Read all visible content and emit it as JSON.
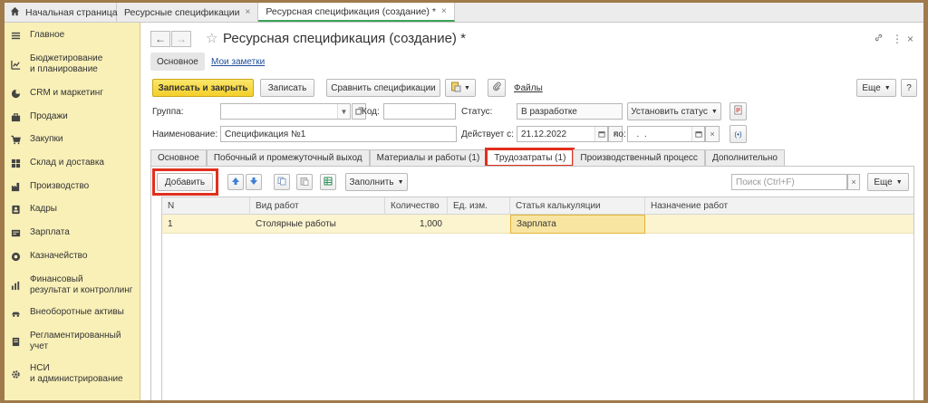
{
  "top_tabs": {
    "home_label": "Начальная страница",
    "tabs": [
      {
        "label": "Ресурсные спецификации",
        "close": "×"
      },
      {
        "label": "Ресурсная спецификация (создание) *",
        "close": "×"
      }
    ]
  },
  "sidebar": {
    "items": [
      {
        "label": "Главное",
        "icon": "menu-icon"
      },
      {
        "label": "Бюджетирование\nи планирование",
        "icon": "budget-icon"
      },
      {
        "label": "CRM и маркетинг",
        "icon": "crm-icon"
      },
      {
        "label": "Продажи",
        "icon": "sales-icon"
      },
      {
        "label": "Закупки",
        "icon": "cart-icon"
      },
      {
        "label": "Склад и доставка",
        "icon": "warehouse-icon"
      },
      {
        "label": "Производство",
        "icon": "factory-icon"
      },
      {
        "label": "Кадры",
        "icon": "staff-icon"
      },
      {
        "label": "Зарплата",
        "icon": "salary-icon"
      },
      {
        "label": "Казначейство",
        "icon": "treasury-icon"
      },
      {
        "label": "Финансовый\nрезультат и контроллинг",
        "icon": "finance-icon"
      },
      {
        "label": "Внеоборотные активы",
        "icon": "assets-icon"
      },
      {
        "label": "Регламентированный\nучет",
        "icon": "accounting-icon"
      },
      {
        "label": "НСИ\nи администрирование",
        "icon": "gear-icon"
      }
    ]
  },
  "header": {
    "back": "←",
    "forward": "→",
    "star": "☆",
    "title": "Ресурсная спецификация (создание) *",
    "link_icon": "🔗",
    "more_icon": "⋮",
    "close_icon": "×"
  },
  "form_tabs_top": {
    "main": "Основное",
    "notes": "Мои заметки"
  },
  "toolbar": {
    "save_close": "Записать и закрыть",
    "save": "Записать",
    "compare": "Сравнить спецификации",
    "files": "Файлы",
    "more": "Еще",
    "help": "?"
  },
  "fields": {
    "group_label": "Группа:",
    "group_value": "",
    "code_label": "Код:",
    "code_value": "",
    "status_label": "Статус:",
    "status_value": "В разработке",
    "set_status": "Установить статус",
    "name_label": "Наименование:",
    "name_value": "Спецификация №1",
    "valid_from_label": "Действует с:",
    "valid_from_value": "21.12.2022",
    "valid_to_label": "по:",
    "valid_to_value": "  .  .",
    "period_icon": "(•)"
  },
  "form_tabs": [
    "Основное",
    "Побочный и промежуточный выход",
    "Материалы и работы (1)",
    "Трудозатраты (1)",
    "Производственный процесс",
    "Дополнительно"
  ],
  "table_toolbar": {
    "add": "Добавить",
    "fill": "Заполнить",
    "search_placeholder": "Поиск (Ctrl+F)",
    "search_clear": "×",
    "more": "Еще"
  },
  "table": {
    "columns": [
      "N",
      "Вид работ",
      "Количество",
      "Ед. изм.",
      "Статья калькуляции",
      "Назначение работ"
    ],
    "rows": [
      [
        "1",
        "Столярные работы",
        "1,000",
        "",
        "Зарплата",
        ""
      ]
    ]
  },
  "colors": {
    "sidebar_bg": "#f9f0b8",
    "primary_button": "#f3cf2a",
    "highlight_red": "#e1301d",
    "selected_row": "#fcf3cf",
    "active_tab_underline": "#3aa35a",
    "link": "#1f4f99"
  }
}
